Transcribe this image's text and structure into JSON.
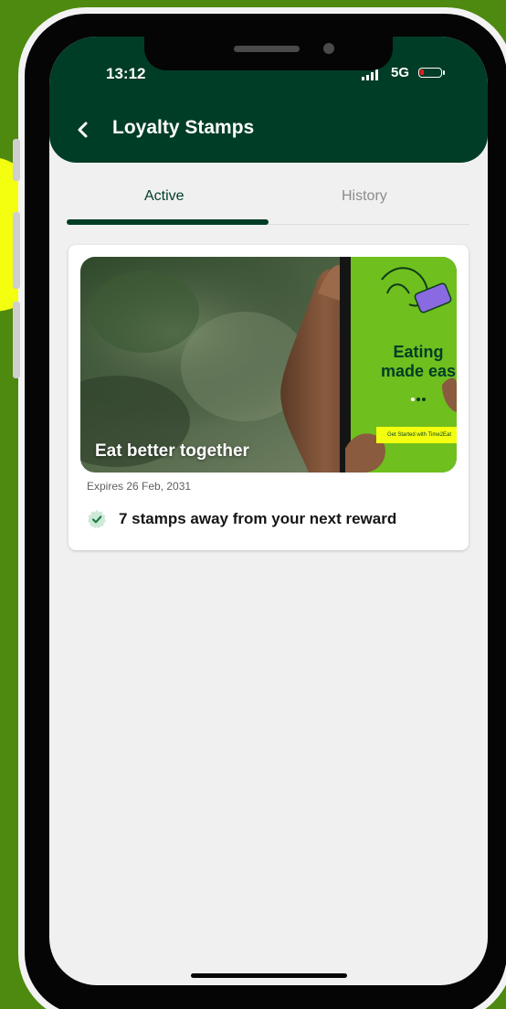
{
  "status_bar": {
    "time": "13:12",
    "network": "5G",
    "battery_color": "#e02020"
  },
  "header": {
    "title": "Loyalty Stamps",
    "back_icon": "chevron-left-icon",
    "background": "#003d26"
  },
  "tabs": [
    {
      "label": "Active",
      "selected": true
    },
    {
      "label": "History",
      "selected": false
    }
  ],
  "card": {
    "banner": {
      "caption": "Eat better together",
      "promo_text_line1": "Eating",
      "promo_text_line2": "made eas",
      "promo_cta": "Get Started with Time2Eat",
      "accent_color": "#6fbf1e"
    },
    "expiry": "Expires 26 Feb, 2031",
    "reward_message": "7 stamps away from your next reward",
    "check_icon": "verified-badge-icon"
  },
  "colors": {
    "background": "#4e8a0f",
    "highlight": "#f4ff10",
    "brand": "#003d26"
  }
}
